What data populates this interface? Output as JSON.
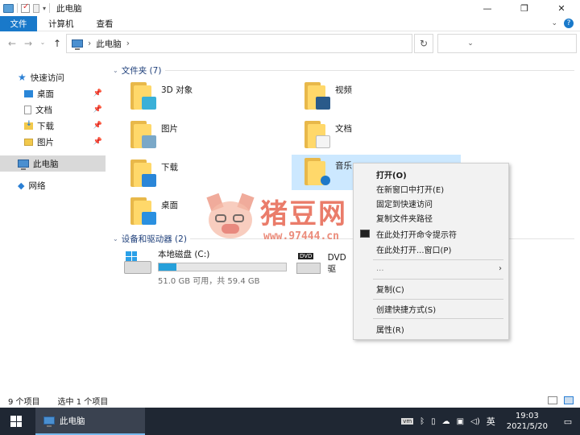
{
  "window": {
    "title": "此电脑",
    "minimize_icon": "minimize-icon",
    "maximize_icon": "maximize-icon",
    "close_icon": "close-icon"
  },
  "ribbon": {
    "tabs": [
      {
        "label": "文件"
      },
      {
        "label": "计算机"
      },
      {
        "label": "查看"
      }
    ]
  },
  "address": {
    "path": "此电脑",
    "search_placeholder": ""
  },
  "nav_pane": {
    "items": [
      {
        "label": "快速访问",
        "icon": "star-icon"
      },
      {
        "label": "桌面",
        "icon": "desktop-icon",
        "pinned": true
      },
      {
        "label": "文档",
        "icon": "document-icon",
        "pinned": true
      },
      {
        "label": "下载",
        "icon": "download-icon",
        "pinned": true
      },
      {
        "label": "图片",
        "icon": "picture-icon",
        "pinned": true
      },
      {
        "label": "此电脑",
        "icon": "pc-icon",
        "selected": true
      },
      {
        "label": "网络",
        "icon": "network-icon"
      }
    ]
  },
  "folders_section": {
    "header": "文件夹 (7)",
    "items": [
      {
        "label": "3D 对象",
        "icon": "3d-objects-icon"
      },
      {
        "label": "视频",
        "icon": "video-icon"
      },
      {
        "label": "图片",
        "icon": "picture-icon"
      },
      {
        "label": "文档",
        "icon": "document-icon"
      },
      {
        "label": "下载",
        "icon": "download-icon"
      },
      {
        "label": "音乐",
        "icon": "music-icon",
        "selected": true
      },
      {
        "label": "桌面",
        "icon": "desktop-icon"
      }
    ]
  },
  "drives_section": {
    "header": "设备和驱动器 (2)",
    "items": [
      {
        "label": "本地磁盘 (C:)",
        "size": "51.0 GB 可用，共 59.4 GB",
        "used_fraction": 0.14
      },
      {
        "label": "DVD 驱",
        "icon": "dvd-drive-icon"
      }
    ]
  },
  "context_menu": {
    "items": [
      {
        "label": "打开(O)",
        "bold": true
      },
      {
        "label": "在新窗口中打开(E)"
      },
      {
        "label": "固定到快速访问"
      },
      {
        "label": "复制文件夹路径"
      },
      {
        "label": "在此处打开命令提示符"
      },
      {
        "label": "在此处打开...窗口(P)"
      },
      {
        "label": "...",
        "submenu": true
      },
      {
        "label": "复制(C)"
      },
      {
        "label": "创建快捷方式(S)"
      },
      {
        "label": "属性(R)"
      }
    ]
  },
  "watermark": {
    "brand": "猪豆网",
    "url": "www.97444.cn"
  },
  "status_bar": {
    "item_count": "9 个项目",
    "selected": "选中 1 个项目"
  },
  "taskbar": {
    "active_window": "此电脑",
    "ime": "英",
    "time": "19:03",
    "date": "2021/5/20"
  },
  "colors": {
    "accent": "#1979ca",
    "selection": "#cce8ff",
    "taskbar": "#1f2733",
    "drive_fill": "#26a0da"
  }
}
